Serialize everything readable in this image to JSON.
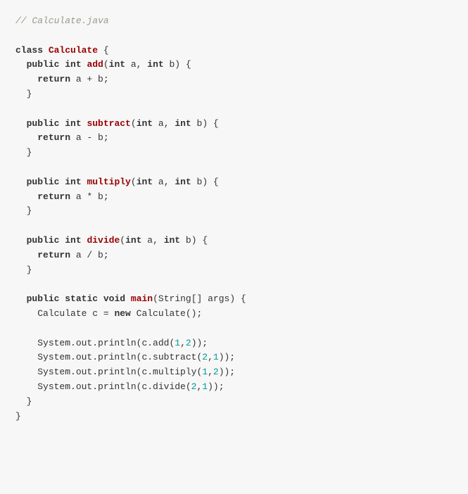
{
  "code": {
    "comment_file": "// Calculate.java",
    "kw_class": "class",
    "class_name": "Calculate",
    "kw_public": "public",
    "kw_int": "int",
    "kw_return": "return",
    "kw_static": "static",
    "kw_void": "void",
    "kw_new": "new",
    "fn_add": "add",
    "fn_subtract": "subtract",
    "fn_multiply": "multiply",
    "fn_divide": "divide",
    "fn_main": "main",
    "sig_int_ab": "(",
    "param_int_a": " a, ",
    "param_int_b": " b) {",
    "ret_a_plus_b": " a + b;",
    "ret_a_minus_b": " a - b;",
    "ret_a_times_b": " a * b;",
    "ret_a_div_b": " a / b;",
    "close_brace": "}",
    "main_sig_open": "(String[] args) {",
    "calc_decl_1": "Calculate c = ",
    "calc_decl_2": " Calculate();",
    "print_prefix": "System.out.println(c.",
    "call_add": "add(",
    "call_subtract": "subtract(",
    "call_multiply": "multiply(",
    "call_divide": "divide(",
    "args_1_2": ",",
    "n1": "1",
    "n2": "2",
    "close_call": "));",
    "open_brace": " {",
    "indent1": "  ",
    "indent2": "    ",
    "indent3": "      "
  }
}
